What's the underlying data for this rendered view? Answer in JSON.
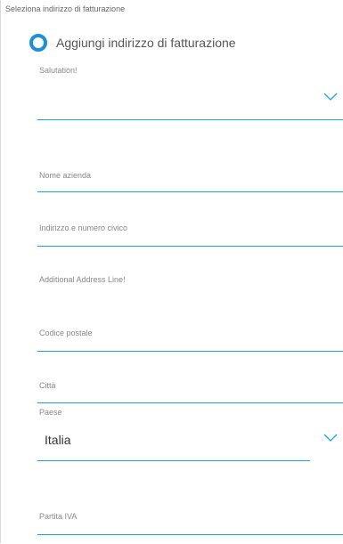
{
  "section": {
    "title": "Seleziona indirizzo di fatturazione"
  },
  "radio": {
    "label": "Aggiungi indirizzo di fatturazione"
  },
  "fields": {
    "salutation": {
      "label": "Salutation!"
    },
    "company": {
      "label": "Nome azienda"
    },
    "address": {
      "label": "Indirizzo e numero civico"
    },
    "additional": {
      "label": "Additional Address Line!"
    },
    "zip": {
      "label": "Codice postale"
    },
    "city": {
      "label": "Città"
    },
    "country": {
      "label": "Paese",
      "value": "Italia"
    },
    "vat": {
      "label": "Partita IVA"
    }
  },
  "colors": {
    "accent": "#1aa3d6",
    "radio": "#1e90d6"
  }
}
